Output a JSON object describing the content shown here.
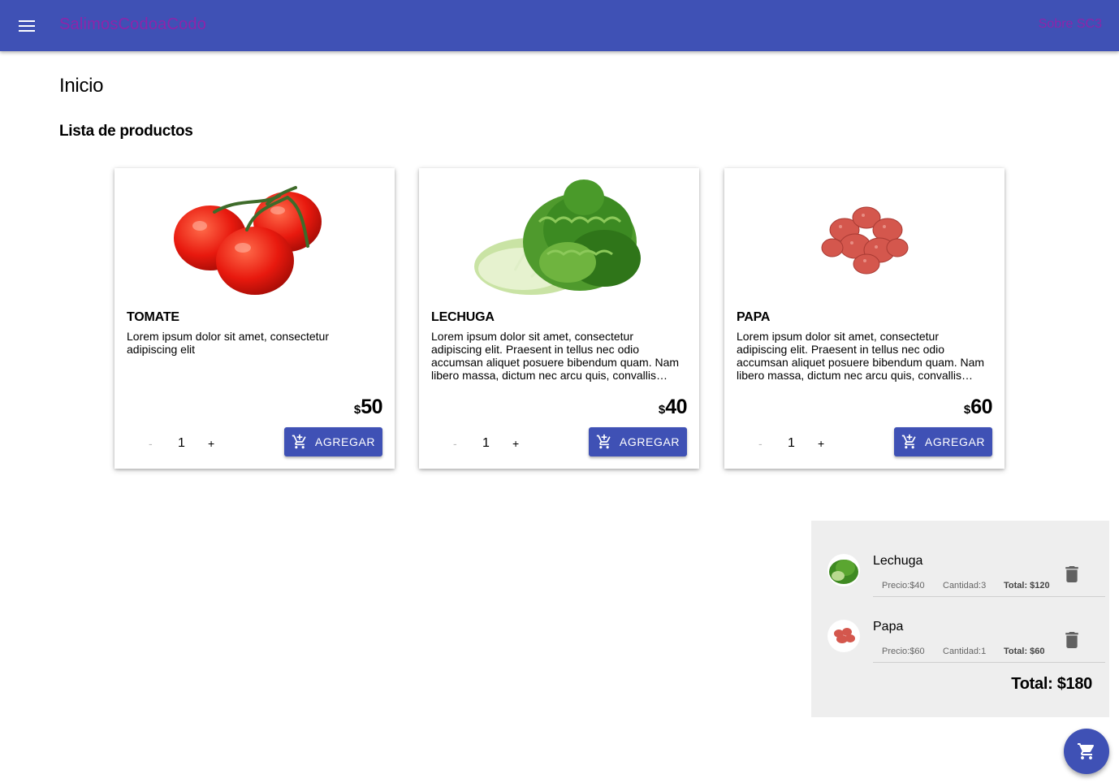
{
  "appbar": {
    "brand": "SalimosCodoaCodo",
    "about_link": "Sobre SC3",
    "menu_icon": "menu-icon",
    "color": "#3f51b5",
    "link_color": "#8e24aa"
  },
  "page": {
    "title": "Inicio",
    "section_title": "Lista de productos"
  },
  "products": [
    {
      "name": "TOMATE",
      "description": "Lorem ipsum dolor sit amet, consectetur adipiscing elit",
      "currency": "$",
      "price": "50",
      "quantity": "1",
      "minus": "-",
      "plus": "+",
      "button_label": "AGREGAR",
      "button_icon": "add-shopping-cart-icon"
    },
    {
      "name": "LECHUGA",
      "description": "Lorem ipsum dolor sit amet, consectetur adipiscing elit. Praesent in tellus nec odio accumsan aliquet posuere bibendum quam. Nam libero massa, dictum nec arcu quis, convallis…",
      "currency": "$",
      "price": "40",
      "quantity": "1",
      "minus": "-",
      "plus": "+",
      "button_label": "AGREGAR",
      "button_icon": "add-shopping-cart-icon"
    },
    {
      "name": "PAPA",
      "description": "Lorem ipsum dolor sit amet, consectetur adipiscing elit. Praesent in tellus nec odio accumsan aliquet posuere bibendum quam. Nam libero massa, dictum nec arcu quis, convallis…",
      "currency": "$",
      "price": "60",
      "quantity": "1",
      "minus": "-",
      "plus": "+",
      "button_label": "AGREGAR",
      "button_icon": "add-shopping-cart-icon"
    }
  ],
  "cart": {
    "items": [
      {
        "name": "Lechuga",
        "precio": "Precio:$40",
        "cantidad": "Cantidad:3",
        "total": "Total: $120",
        "delete_icon": "trash-icon"
      },
      {
        "name": "Papa",
        "precio": "Precio:$60",
        "cantidad": "Cantidad:1",
        "total": "Total: $60",
        "delete_icon": "trash-icon"
      }
    ],
    "grand_total": "Total: $180"
  },
  "fab": {
    "icon": "shopping-cart-icon"
  }
}
